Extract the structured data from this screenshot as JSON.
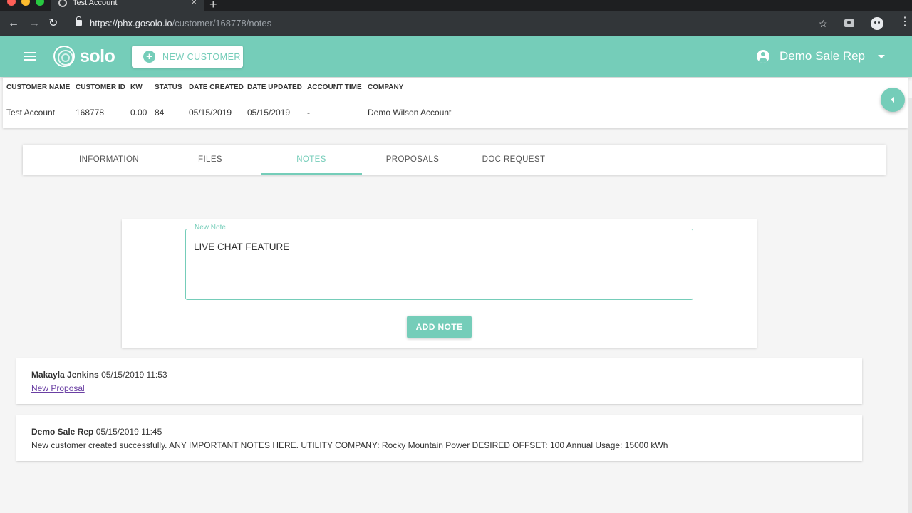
{
  "browser": {
    "tab_title": "Test Account",
    "tab_close": "×",
    "new_tab": "+",
    "url_host": "https://phx.gosolo.io",
    "url_path": "/customer/168778/notes",
    "back": "←",
    "forward": "→",
    "reload": "↻",
    "star": "☆",
    "menu": "⋮"
  },
  "header": {
    "logo_text": "solo",
    "new_customer_label": "NEW CUSTOMER",
    "plus_glyph": "+",
    "user_name": "Demo Sale Rep",
    "accent_color": "#75cdb9"
  },
  "summary": {
    "headers": [
      "CUSTOMER NAME",
      "CUSTOMER ID",
      "KW",
      "STATUS",
      "DATE CREATED",
      "DATE UPDATED",
      "ACCOUNT TIME",
      "COMPANY"
    ],
    "values": [
      "Test Account",
      "168778",
      "0.00",
      "84",
      "05/15/2019",
      "05/15/2019",
      "-",
      "Demo Wilson Account"
    ]
  },
  "tabs": [
    {
      "label": "INFORMATION",
      "active": false
    },
    {
      "label": "FILES",
      "active": false
    },
    {
      "label": "NOTES",
      "active": true
    },
    {
      "label": "PROPOSALS",
      "active": false
    },
    {
      "label": "DOC REQUEST",
      "active": false
    }
  ],
  "new_note": {
    "label": "New Note",
    "value": "LIVE CHAT FEATURE",
    "button": "ADD NOTE"
  },
  "notes": [
    {
      "author": "Makayla Jenkins",
      "timestamp": "05/15/2019 11:53",
      "body": "New Proposal",
      "is_link": true
    },
    {
      "author": "Demo Sale Rep",
      "timestamp": "05/15/2019 11:45",
      "body": "New customer created successfully. ANY IMPORTANT NOTES HERE. UTILITY COMPANY: Rocky Mountain Power DESIRED OFFSET: 100 Annual Usage: 15000 kWh",
      "is_link": false
    }
  ]
}
